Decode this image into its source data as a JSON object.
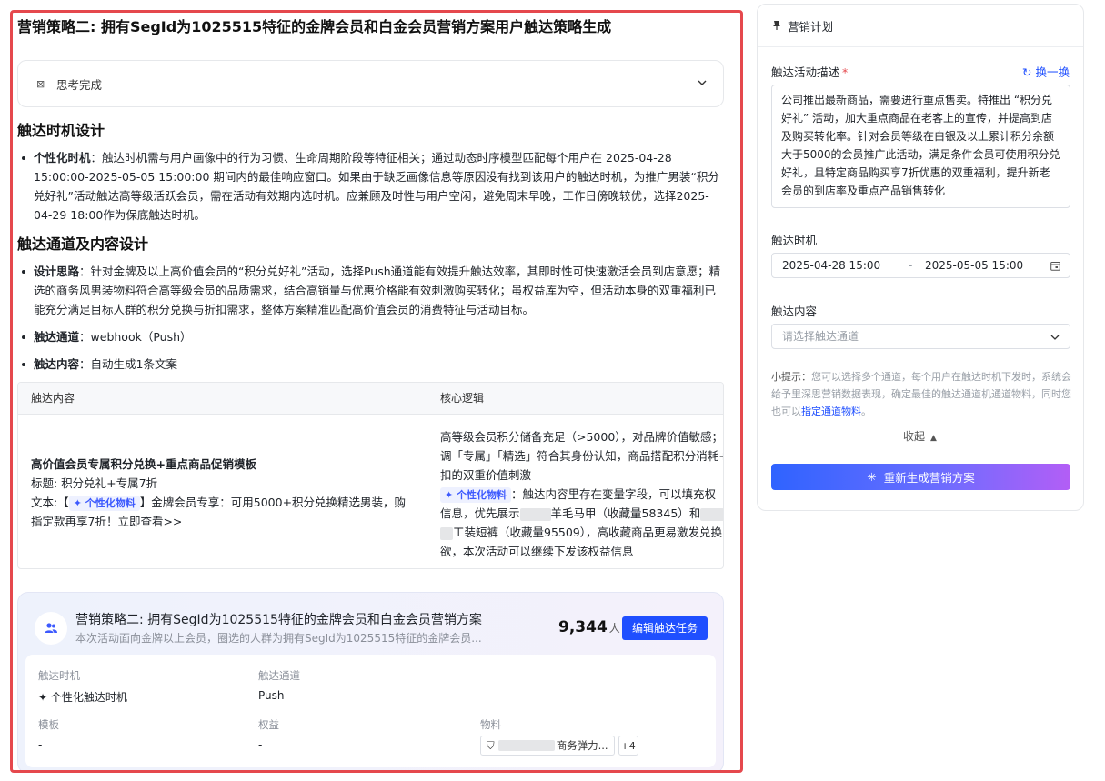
{
  "main": {
    "title": "营销策略二: 拥有SegId为1025515特征的金牌会员和白金会员营销方案用户触达策略生成",
    "think_label": "思考完成",
    "section1_title": "触达时机设计",
    "section1_items": [
      {
        "key": "个性化时机",
        "sep": "：",
        "text": "触达时机需与用户画像中的行为习惯、生命周期阶段等特征相关；通过动态时序模型匹配每个用户在 2025-04-28 15:00:00-2025-05-05 15:00:00 期间内的最佳响应窗口。如果由于缺乏画像信息等原因没有找到该用户的触达时机，为推广男装“积分兑好礼”活动触达高等级活跃会员，需在活动有效期内选时机。应兼顾及时性与用户空闲，避免周末早晚，工作日傍晚较优，选择2025-04-29 18:00作为保底触达时机。"
      }
    ],
    "section2_title": "触达通道及内容设计",
    "section2_items": [
      {
        "key": "设计思路",
        "sep": "：",
        "text": "针对金牌及以上高价值会员的“积分兑好礼”活动，选择Push通道能有效提升触达效率，其即时性可快速激活会员到店意愿；精选的商务风男装物料符合高等级会员的品质需求，结合高销量与优惠价格能有效刺激购买转化；虽权益库为空，但活动本身的双重福利已能充分满足目标人群的积分兑换与折扣需求，整体方案精准匹配高价值会员的消费特征与活动目标。"
      },
      {
        "key": "触达通道",
        "sep": "：",
        "text": "webhook（Push）"
      },
      {
        "key": "触达内容",
        "sep": "：",
        "text": "自动生成1条文案"
      }
    ],
    "table": {
      "headers": [
        "触达内容",
        "核心逻辑"
      ],
      "template_title": "高价值会员专属积分兑换+重点商品促销模板",
      "subject_line": "标题: 积分兑礼+专属7折",
      "body_prefix": "文本:【",
      "tag_label": "个性化物料",
      "body_suffix": "】金牌会员专享：可用5000+积分兑换精选男装，购",
      "body_line2": "指定款再享7折！立即查看>>",
      "logic_line1": "高等级会员积分储备充足（>5000），对品牌价值敏感；强",
      "logic_line2": "调「专属」「精选」符合其身份认知，商品搭配积分消耗+",
      "logic_line3": "扣的双重价值刺激",
      "logic_tag": "个性化物料",
      "logic_line4": "：触达内容里存在变量字段，可以填充权",
      "logic_line5a": "信息，优先展示",
      "logic_line5b": "羊毛马甲（收藏量58345）和",
      "logic_line6": "工装短裤（收藏量95509），高收藏商品更易激发兑换",
      "logic_line7": "欲，本次活动可以继续下发该权益信息"
    },
    "card": {
      "title": "营销策略二: 拥有SegId为1025515特征的金牌会员和白金会员营销方案",
      "subtitle": "本次活动面向金牌以上会员，圈选的人群为拥有SegId为1025515特征的金牌会员...",
      "count": "9,344",
      "count_unit": "人",
      "edit_label": "编辑触达任务",
      "f_time_label": "触达时机",
      "f_time_value": "个性化触达时机",
      "f_channel_label": "触达通道",
      "f_channel_value": "Push",
      "f_template_label": "模板",
      "f_template_value": "-",
      "f_rights_label": "权益",
      "f_rights_value": "-",
      "f_material_label": "物料",
      "f_material_value": "商务弹力...",
      "f_material_more": "+4"
    }
  },
  "plan": {
    "title": "营销计划",
    "desc_label": "触达活动描述",
    "required_mark": "*",
    "swap_label": "换一换",
    "desc_text": "公司推出最新商品，需要进行重点售卖。特推出 “积分兑好礼” 活动，加大重点商品在老客上的宣传，并提高到店及购买转化率。针对会员等级在白银及以上累计积分余额大于5000的会员推广此活动，满足条件会员可使用积分兑好礼，且特定商品购买享7折优惠的双重福利，提升新老会员的到店率及重点产品销售转化",
    "time_label": "触达时机",
    "date_start": "2025-04-28 15:00",
    "date_sep": "-",
    "date_end": "2025-05-05 15:00",
    "content_label": "触达内容",
    "content_placeholder": "请选择触达通道",
    "hint_prefix": "小提示：",
    "hint_text": "您可以选择多个通道，每个用户在触达时机下发时，系统会给予里深思营销数据表现，确定最佳的触达通道机通道物料，同时您也可以",
    "hint_link": "指定通道物料",
    "hint_end": "。",
    "collapse_label": "收起",
    "regen_label": "重新生成营销方案"
  }
}
